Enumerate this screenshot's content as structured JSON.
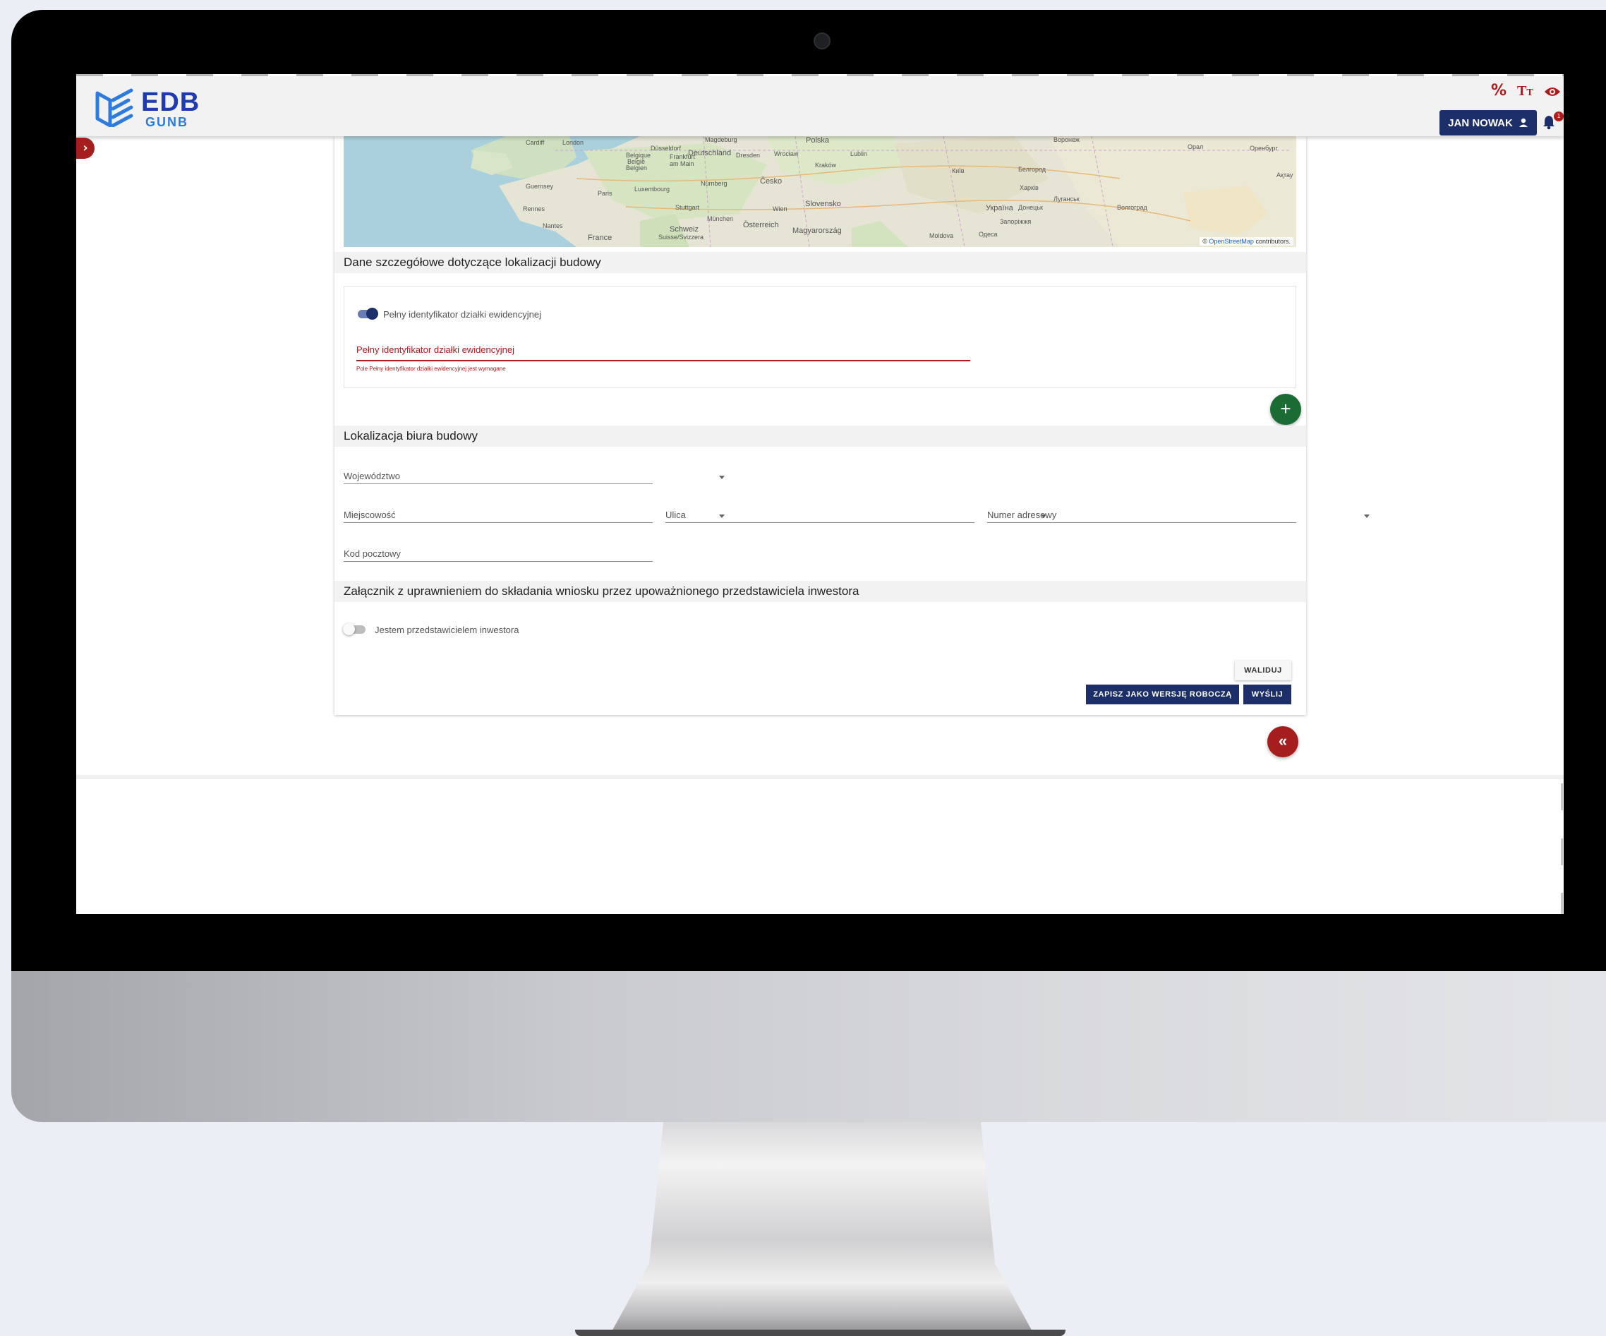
{
  "header": {
    "logo_text": "EDB",
    "logo_subtext": "GUNB",
    "user_label": "JAN NOWAK",
    "notification_count": "1",
    "accessibility_icons": [
      "accessibility-icon",
      "font-size-icon",
      "contrast-eye-icon"
    ]
  },
  "map": {
    "attribution_prefix": "©",
    "attribution_link": "OpenStreetMap",
    "attribution_suffix": "contributors.",
    "city_labels": [
      "London",
      "Cardiff",
      "Magdeburg",
      "Düsseldorf",
      "Deutschland",
      "Belgique",
      "België",
      "Belgien",
      "Frankfurt am Main",
      "Dresden",
      "Wrocław",
      "Kraków",
      "Lublin",
      "Polska",
      "Guernsey",
      "Paris",
      "Luxembourg",
      "Nürnberg",
      "Česko",
      "Rennes",
      "Stuttgart",
      "München",
      "Österreich",
      "Wien",
      "Slovensko",
      "Nantes",
      "Schweiz",
      "Suisse/Svizzera",
      "France",
      "Magyarország",
      "Moldova",
      "Україна",
      "Київ",
      "Одеса",
      "Воронеж",
      "Белгород",
      "Харків",
      "Донецьк",
      "Запоріжжя",
      "Луганськ",
      "Волгоград",
      "Оренбург",
      "Орал",
      "Ақтау"
    ]
  },
  "sections": {
    "parcel": {
      "title": "Dane szczegółowe dotyczące lokalizacji budowy",
      "toggle_label": "Pełny identyfikator działki ewidencyjnej",
      "toggle_on": true,
      "field_label": "Pełny identyfikator działki ewidencyjnej",
      "field_value": "",
      "error_text": "Pole Pełny identyfikator działki ewidencyjnej jest wymagane",
      "add_button": "+"
    },
    "office": {
      "title": "Lokalizacja biura budowy",
      "voivodeship_label": "Województwo",
      "city_label": "Miejscowość",
      "street_label": "Ulica",
      "number_label": "Numer adresowy",
      "postcode_label": "Kod pocztowy"
    },
    "attachment": {
      "title": "Załącznik z uprawnieniem do składania wniosku przez upoważnionego przedstawiciela inwestora",
      "toggle_label": "Jestem przedstawicielem inwestora",
      "toggle_on": false
    }
  },
  "actions": {
    "validate": "WALIDUJ",
    "save_draft": "ZAPISZ JAKO WERSJĘ ROBOCZĄ",
    "send": "WYŚLIJ",
    "collapse": "«"
  },
  "colors": {
    "primary": "#1c2f6a",
    "error": "#b01c1c",
    "success": "#1b6b35",
    "logo": "#1f3bb3"
  }
}
